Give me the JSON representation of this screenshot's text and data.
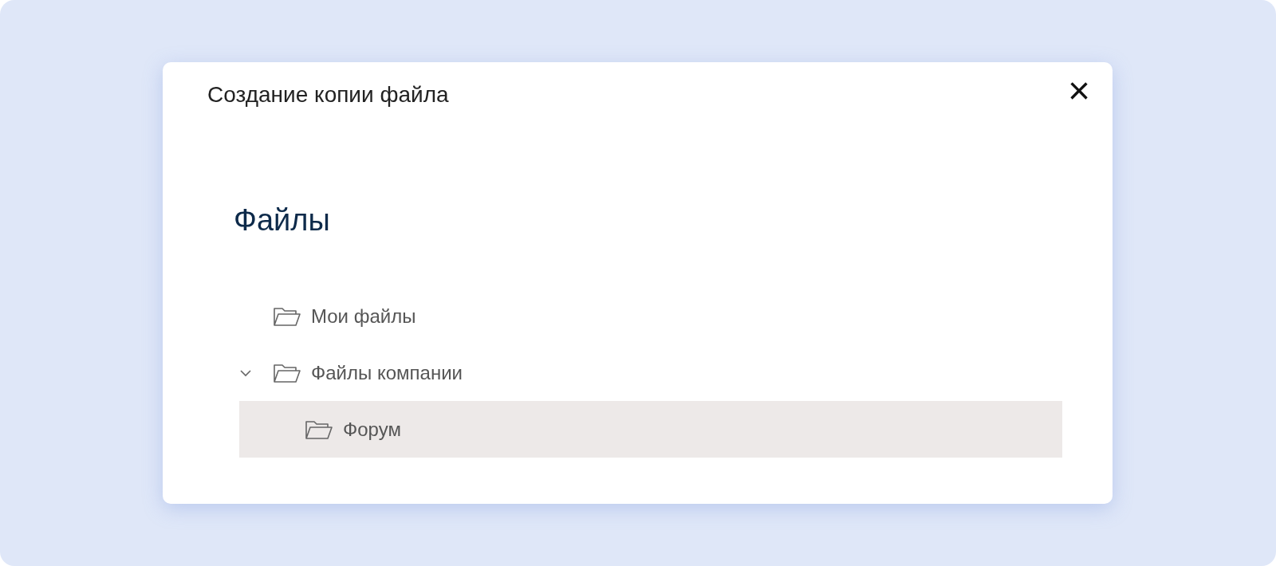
{
  "dialog": {
    "title": "Создание копии файла",
    "close": "×"
  },
  "heading": "Файлы",
  "tree": [
    {
      "label": "Мои файлы",
      "selected": false
    },
    {
      "label": "Файлы компании",
      "selected": false,
      "expanded": true,
      "children": [
        {
          "label": "Форум",
          "selected": true
        }
      ]
    }
  ]
}
